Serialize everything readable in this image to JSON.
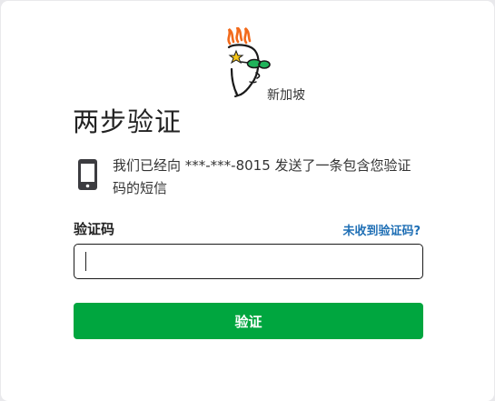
{
  "brand": {
    "logo_icon": "godaddy-guy-logo",
    "region": "新加坡"
  },
  "page": {
    "title": "两步验证",
    "message": "我们已经向 ***-***-8015 发送了一条包含您验证码的短信",
    "phone_icon": "mobile-phone-icon"
  },
  "form": {
    "code_label": "验证码",
    "resend_link": "未收到验证码?",
    "code_value": "",
    "code_placeholder": "",
    "submit_label": "验证"
  },
  "colors": {
    "accent_green": "#00a63f",
    "link_blue": "#1f6fb5",
    "logo_orange": "#f26a1b",
    "logo_green": "#1fb35a"
  }
}
